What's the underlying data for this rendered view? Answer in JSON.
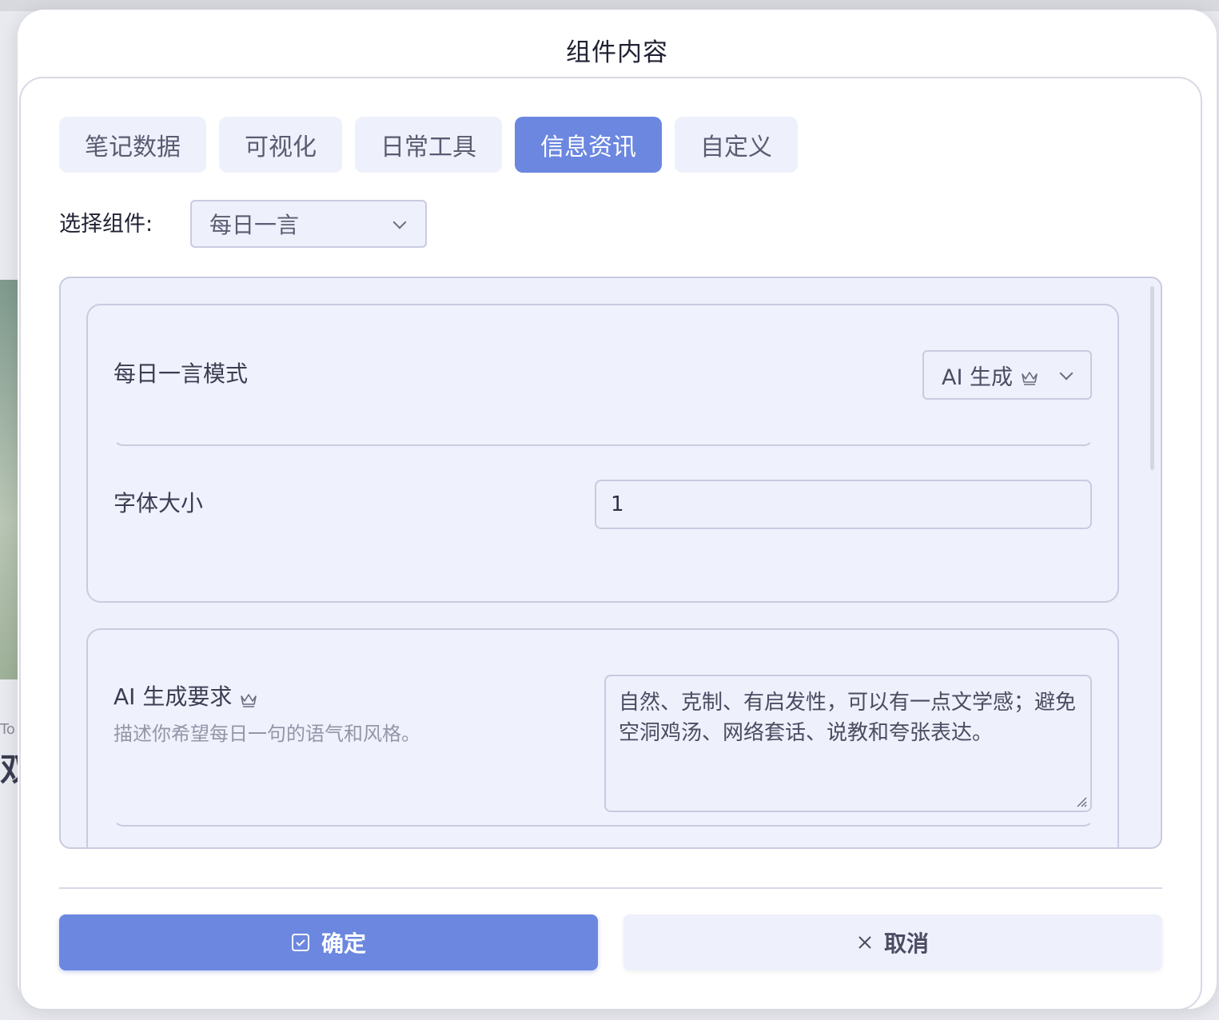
{
  "dialog": {
    "title": "组件内容"
  },
  "tabs": [
    {
      "label": "笔记数据",
      "active": false
    },
    {
      "label": "可视化",
      "active": false
    },
    {
      "label": "日常工具",
      "active": false
    },
    {
      "label": "信息资讯",
      "active": true
    },
    {
      "label": "自定义",
      "active": false
    }
  ],
  "component_select": {
    "label": "选择组件:",
    "value": "每日一言"
  },
  "settings": {
    "mode": {
      "label": "每日一言模式",
      "value": "AI 生成",
      "icon": "crown-icon"
    },
    "font_size": {
      "label": "字体大小",
      "value": "1"
    },
    "ai_request": {
      "label": "AI 生成要求",
      "icon": "crown-icon",
      "description": "描述你希望每日一句的语气和风格。",
      "value": "自然、克制、有启发性，可以有一点文学感；避免空洞鸡汤、网络套话、说教和夸张表达。"
    }
  },
  "footer": {
    "confirm_label": "确定",
    "cancel_label": "取消"
  },
  "colors": {
    "accent": "#6b87e0",
    "panel": "#eef0fb",
    "border": "#c9cbe0"
  },
  "backdrop": {
    "frag1": "To",
    "frag2": "双"
  }
}
